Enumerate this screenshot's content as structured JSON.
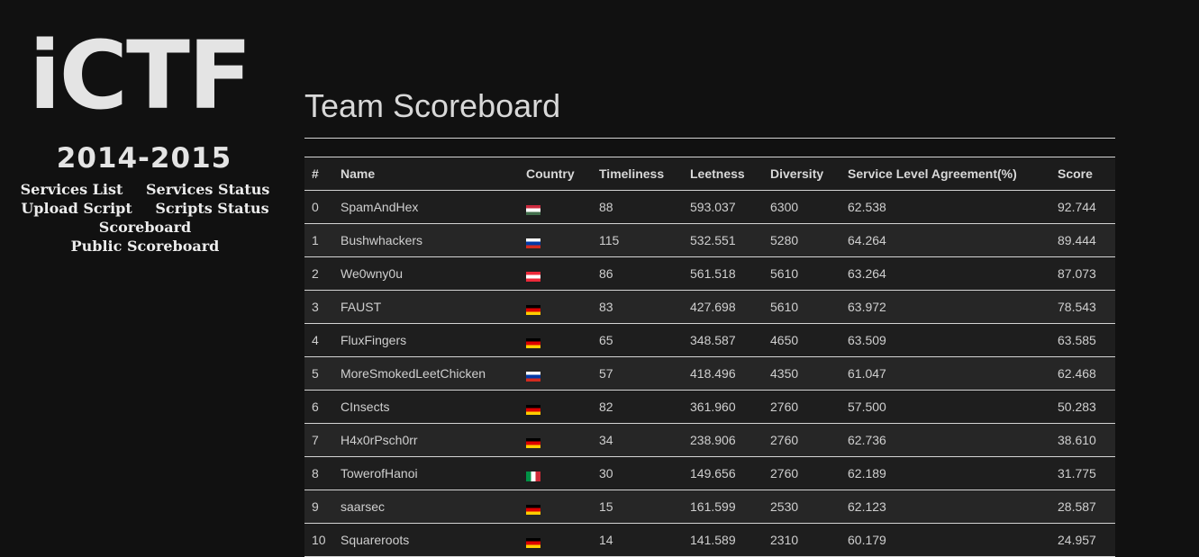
{
  "sidebar": {
    "logo": "iCTF",
    "years": "2014-2015",
    "nav": [
      [
        "Services List",
        "Services Status"
      ],
      [
        "Upload Script",
        "Scripts Status"
      ],
      [
        "Scoreboard"
      ],
      [
        "Public Scoreboard"
      ]
    ]
  },
  "main": {
    "title": "Team Scoreboard",
    "columns": [
      "#",
      "Name",
      "Country",
      "Timeliness",
      "Leetness",
      "Diversity",
      "Service Level Agreement(%)",
      "Score"
    ],
    "rows": [
      {
        "rank": "0",
        "name": "SpamAndHex",
        "country": "hu-flag-icon",
        "timeliness": "88",
        "leetness": "593.037",
        "diversity": "6300",
        "sla": "62.538",
        "score": "92.744"
      },
      {
        "rank": "1",
        "name": "Bushwhackers",
        "country": "ru-flag-icon",
        "timeliness": "115",
        "leetness": "532.551",
        "diversity": "5280",
        "sla": "64.264",
        "score": "89.444"
      },
      {
        "rank": "2",
        "name": "We0wny0u",
        "country": "at-flag-icon",
        "timeliness": "86",
        "leetness": "561.518",
        "diversity": "5610",
        "sla": "63.264",
        "score": "87.073"
      },
      {
        "rank": "3",
        "name": "FAUST",
        "country": "de-flag-icon",
        "timeliness": "83",
        "leetness": "427.698",
        "diversity": "5610",
        "sla": "63.972",
        "score": "78.543"
      },
      {
        "rank": "4",
        "name": "FluxFingers",
        "country": "de-flag-icon",
        "timeliness": "65",
        "leetness": "348.587",
        "diversity": "4650",
        "sla": "63.509",
        "score": "63.585"
      },
      {
        "rank": "5",
        "name": "MoreSmokedLeetChicken",
        "country": "ru-flag-icon",
        "timeliness": "57",
        "leetness": "418.496",
        "diversity": "4350",
        "sla": "61.047",
        "score": "62.468"
      },
      {
        "rank": "6",
        "name": "CInsects",
        "country": "de-flag-icon",
        "timeliness": "82",
        "leetness": "361.960",
        "diversity": "2760",
        "sla": "57.500",
        "score": "50.283"
      },
      {
        "rank": "7",
        "name": "H4x0rPsch0rr",
        "country": "de-flag-icon",
        "timeliness": "34",
        "leetness": "238.906",
        "diversity": "2760",
        "sla": "62.736",
        "score": "38.610"
      },
      {
        "rank": "8",
        "name": "TowerofHanoi",
        "country": "it-flag-icon",
        "timeliness": "30",
        "leetness": "149.656",
        "diversity": "2760",
        "sla": "62.189",
        "score": "31.775"
      },
      {
        "rank": "9",
        "name": "saarsec",
        "country": "de-flag-icon",
        "timeliness": "15",
        "leetness": "161.599",
        "diversity": "2530",
        "sla": "62.123",
        "score": "28.587"
      },
      {
        "rank": "10",
        "name": "Squareroots",
        "country": "de-flag-icon",
        "timeliness": "14",
        "leetness": "141.589",
        "diversity": "2310",
        "sla": "60.179",
        "score": "24.957"
      }
    ]
  }
}
